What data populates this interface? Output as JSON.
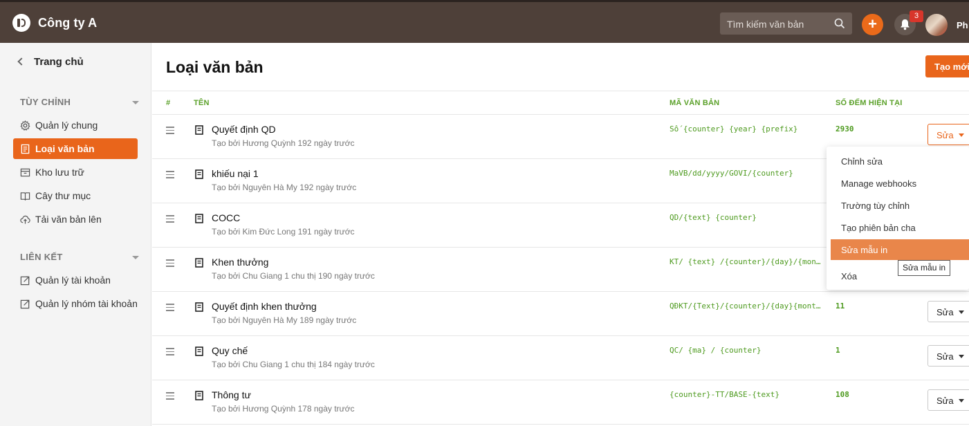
{
  "header": {
    "company": "Công ty A",
    "search_placeholder": "Tìm kiếm văn bản",
    "notification_count": "3",
    "username": "Ph"
  },
  "sidebar": {
    "back_label": "Trang chủ",
    "sections": [
      {
        "title": "TÙY CHỈNH",
        "items": [
          {
            "label": "Quản lý chung",
            "icon": "gear-icon"
          },
          {
            "label": "Loại văn bản",
            "icon": "document-list-icon",
            "active": true
          },
          {
            "label": "Kho lưu trữ",
            "icon": "archive-icon"
          },
          {
            "label": "Cây thư mục",
            "icon": "book-icon"
          },
          {
            "label": "Tải văn bản lên",
            "icon": "cloud-upload-icon"
          }
        ]
      },
      {
        "title": "LIÊN KẾT",
        "items": [
          {
            "label": "Quản lý tài khoản",
            "icon": "external-link-icon"
          },
          {
            "label": "Quản lý nhóm tài khoản",
            "icon": "external-link-icon"
          }
        ]
      }
    ]
  },
  "main": {
    "title": "Loại văn bản",
    "create_label": "Tạo mới",
    "columns": {
      "index": "#",
      "name": "TÊN",
      "code": "MÃ VĂN BẢN",
      "counter": "SỐ ĐẾM HIỆN TẠI"
    },
    "edit_label": "Sửa",
    "rows": [
      {
        "name": "Quyết định QD",
        "sub": "Tạo bởi Hương Quỳnh 192 ngày trước",
        "code": "Số {counter} {year} {prefix}",
        "count": "2930"
      },
      {
        "name": "khiếu nại 1",
        "sub": "Tạo bởi Nguyên Hà My 192 ngày trước",
        "code": "MaVB/dd/yyyy/GOVI/{counter}",
        "count": ""
      },
      {
        "name": "COCC",
        "sub": "Tạo bởi Kim Đức Long 191 ngày trước",
        "code": "QD/{text} {counter}",
        "count": ""
      },
      {
        "name": "Khen thưởng",
        "sub": "Tạo bởi Chu Giang 1 chu thị 190 ngày trước",
        "code": "KT/ {text} /{counter}/{day}/{mon…",
        "count": ""
      },
      {
        "name": "Quyết định khen thưởng",
        "sub": "Tạo bởi Nguyên Hà My 189 ngày trước",
        "code": "QĐKT/{Text}/{counter}/{day}{mont…",
        "count": "11"
      },
      {
        "name": "Quy chế",
        "sub": "Tạo bởi Chu Giang 1 chu thị 184 ngày trước",
        "code": "QC/ {ma} / {counter}",
        "count": "1"
      },
      {
        "name": "Thông tư",
        "sub": "Tạo bởi Hương Quỳnh 178 ngày trước",
        "code": "{counter}-TT/BASE-{text}",
        "count": "108"
      }
    ],
    "dropdown": {
      "items": [
        "Chỉnh sửa",
        "Manage webhooks",
        "Trường tùy chỉnh",
        "Tạo phiên bản cha",
        "Sửa mẫu in",
        "Xóa"
      ],
      "highlighted": "Sửa mẫu in",
      "tooltip": "Sửa mẫu in"
    }
  },
  "colors": {
    "header": "#4e4039",
    "accent": "#e9651b",
    "code_green": "#4d9a1e"
  }
}
